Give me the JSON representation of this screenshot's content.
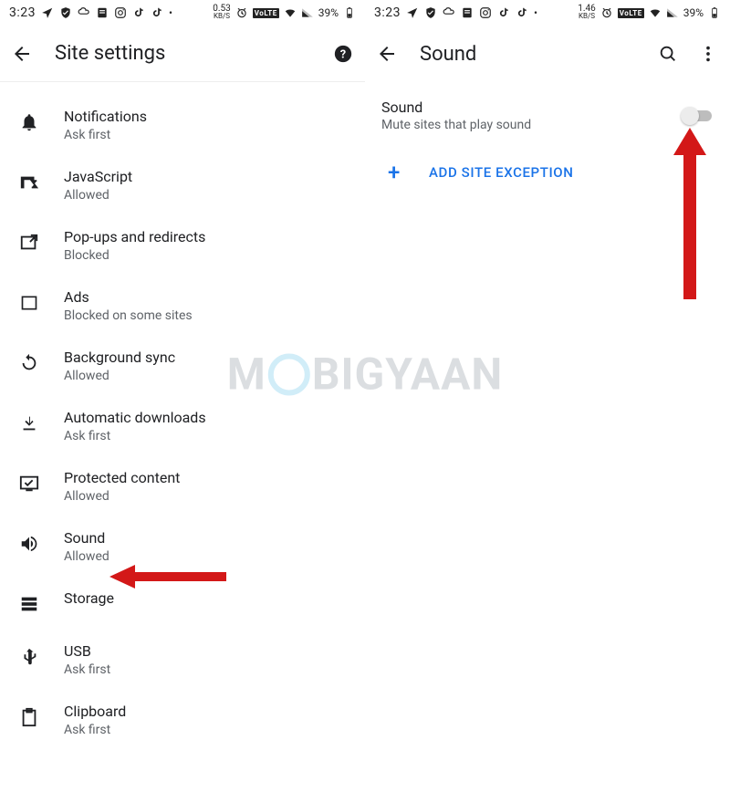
{
  "statusbar": {
    "time": "3:23",
    "kbs_left": "0.53",
    "kbs_right": "1.46",
    "kbs_unit": "KB/S",
    "volte": "VoLTE",
    "battery": "39%"
  },
  "left": {
    "title": "Site settings",
    "items": [
      {
        "icon": "bell",
        "title": "Notifications",
        "sub": "Ask first"
      },
      {
        "icon": "js",
        "title": "JavaScript",
        "sub": "Allowed"
      },
      {
        "icon": "popup",
        "title": "Pop-ups and redirects",
        "sub": "Blocked"
      },
      {
        "icon": "ads",
        "title": "Ads",
        "sub": "Blocked on some sites"
      },
      {
        "icon": "sync",
        "title": "Background sync",
        "sub": "Allowed"
      },
      {
        "icon": "download",
        "title": "Automatic downloads",
        "sub": "Ask first"
      },
      {
        "icon": "protected",
        "title": "Protected content",
        "sub": "Allowed"
      },
      {
        "icon": "sound",
        "title": "Sound",
        "sub": "Allowed"
      },
      {
        "icon": "storage",
        "title": "Storage",
        "sub": ""
      },
      {
        "icon": "usb",
        "title": "USB",
        "sub": "Ask first"
      },
      {
        "icon": "clipboard",
        "title": "Clipboard",
        "sub": "Ask first"
      }
    ]
  },
  "right": {
    "title": "Sound",
    "sound_title": "Sound",
    "sound_sub": "Mute sites that play sound",
    "add_label": "ADD SITE EXCEPTION"
  },
  "watermark": {
    "pre": "M",
    "post": "BIGYAAN"
  }
}
